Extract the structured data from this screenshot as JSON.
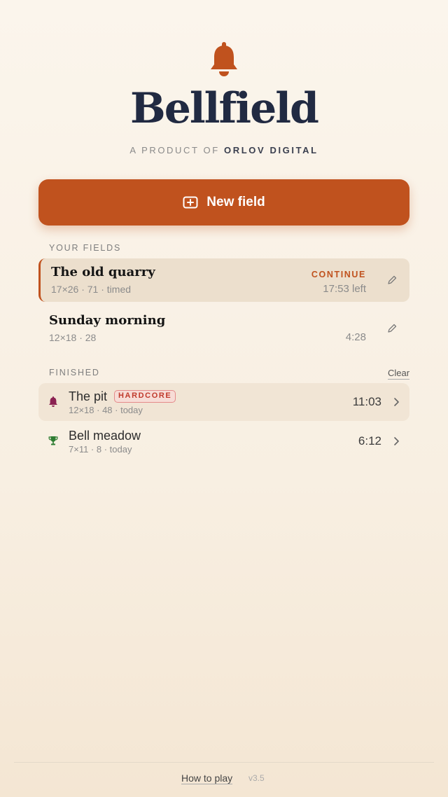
{
  "app": {
    "logo_icon": "bell-icon",
    "title": "Bellfield",
    "subtitle_prefix": "A PRODUCT OF",
    "subtitle_brand": "ORLOV DIGITAL",
    "accent_color": "#c0521e"
  },
  "new_field": {
    "icon": "plus-square-icon",
    "label": "New field"
  },
  "your_fields": {
    "label": "YOUR FIELDS",
    "items": [
      {
        "name": "The old quarry",
        "meta": "17×26 · 71 · timed",
        "status": "CONTINUE",
        "time": "17:53 left",
        "active": true,
        "icon": "pencil-icon"
      },
      {
        "name": "Sunday morning",
        "meta": "12×18 · 28",
        "status": "",
        "time": "4:28",
        "active": false,
        "icon": "pencil-icon"
      }
    ]
  },
  "finished": {
    "label": "FINISHED",
    "clear_label": "Clear",
    "items": [
      {
        "name": "The pit",
        "badge": "HARDCORE",
        "meta": "12×18 · 48 · today",
        "time": "11:03",
        "icon": "bell-icon",
        "icon_color": "#8b2252"
      },
      {
        "name": "Bell meadow",
        "badge": "",
        "meta": "7×11 · 8 · today",
        "time": "6:12",
        "icon": "trophy-icon",
        "icon_color": "#2e7d32"
      }
    ]
  },
  "footer": {
    "how_to_play": "How to play",
    "version": "v3.5"
  }
}
